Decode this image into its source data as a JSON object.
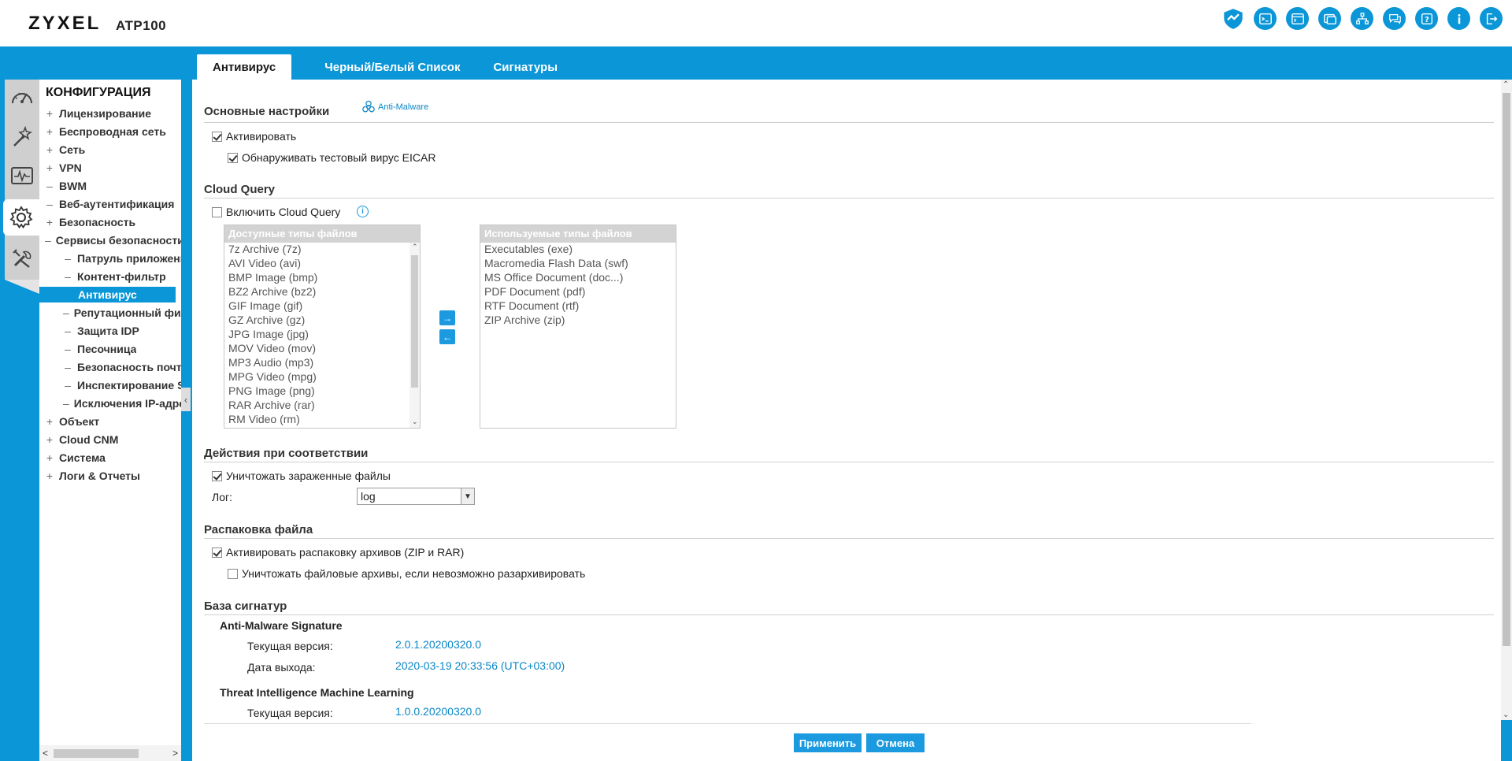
{
  "header": {
    "brand": "ZYXEL",
    "model": "ATP100",
    "icons": [
      "shield-icon",
      "console-icon",
      "cli-icon",
      "browser-window-icon",
      "network-map-icon",
      "chat-icon",
      "help-icon",
      "info-icon",
      "logout-icon"
    ]
  },
  "tabs": [
    {
      "label": "Антивирус",
      "active": true
    },
    {
      "label": "Черный/Белый Список",
      "active": false
    },
    {
      "label": "Сигнатуры",
      "active": false
    }
  ],
  "nav": {
    "title": "КОНФИГУРАЦИЯ",
    "items": [
      {
        "pm": "+",
        "label": "Лицензирование"
      },
      {
        "pm": "+",
        "label": "Беспроводная сеть"
      },
      {
        "pm": "+",
        "label": "Сеть"
      },
      {
        "pm": "+",
        "label": "VPN"
      },
      {
        "pm": "–",
        "label": "BWM"
      },
      {
        "pm": "–",
        "label": "Веб-аутентификация"
      },
      {
        "pm": "+",
        "label": "Безопасность"
      },
      {
        "pm": "–",
        "label": "Сервисы безопасности"
      },
      {
        "pm": "–",
        "label": "Патруль приложений"
      },
      {
        "pm": "–",
        "label": "Контент-фильтр"
      },
      {
        "pm": "",
        "label": "Антивирус"
      },
      {
        "pm": "–",
        "label": "Репутационный фильтр"
      },
      {
        "pm": "–",
        "label": "Защита IDP"
      },
      {
        "pm": "–",
        "label": "Песочница"
      },
      {
        "pm": "–",
        "label": "Безопасность почты"
      },
      {
        "pm": "–",
        "label": "Инспектирование SSL"
      },
      {
        "pm": "–",
        "label": "Исключения IP-адресов"
      },
      {
        "pm": "+",
        "label": "Объект"
      },
      {
        "pm": "+",
        "label": "Cloud CNM"
      },
      {
        "pm": "+",
        "label": "Система"
      },
      {
        "pm": "+",
        "label": "Логи & Отчеты"
      }
    ]
  },
  "content": {
    "basic": {
      "title": "Основные настройки",
      "badge": "Anti-Malware",
      "activate": "Активировать",
      "eicar": "Обнаруживать тестовый вирус EICAR"
    },
    "cloud": {
      "title": "Cloud Query",
      "enable": "Включить Cloud Query",
      "available_header": "Доступные типы файлов",
      "used_header": "Используемые типы файлов",
      "available": [
        "7z Archive (7z)",
        "AVI Video (avi)",
        "BMP Image (bmp)",
        "BZ2 Archive (bz2)",
        "GIF Image (gif)",
        "GZ Archive (gz)",
        "JPG Image (jpg)",
        "MOV Video (mov)",
        "MP3 Audio (mp3)",
        "MPG Video (mpg)",
        "PNG Image (png)",
        "RAR Archive (rar)",
        "RM Video (rm)"
      ],
      "used": [
        "Executables (exe)",
        "Macromedia Flash Data (swf)",
        "MS Office Document (doc...)",
        "PDF Document (pdf)",
        "RTF Document (rtf)",
        "ZIP Archive (zip)"
      ],
      "add": "→",
      "remove": "←"
    },
    "actions": {
      "title": "Действия при соответствии",
      "destroy": "Уничтожать зараженные файлы",
      "log_label": "Лог:",
      "log_value": "log"
    },
    "unpack": {
      "title": "Распаковка файла",
      "enable": "Активировать распаковку архивов (ZIP и RAR)",
      "destroy": "Уничтожать файловые архивы, если невозможно разархивировать"
    },
    "sigdb": {
      "title": "База сигнатур",
      "am_title": "Anti-Malware Signature",
      "cur_label": "Текущая версия:",
      "am_version": "2.0.1.20200320.0",
      "date_label": "Дата выхода:",
      "am_date": "2020-03-19 20:33:56 (UTC+03:00)",
      "ml_title": "Threat Intelligence Machine Learning",
      "ml_cur_label": "Текущая версия:",
      "ml_version": "1.0.0.20200320.0"
    },
    "apply": "Применить",
    "cancel": "Отмена"
  }
}
